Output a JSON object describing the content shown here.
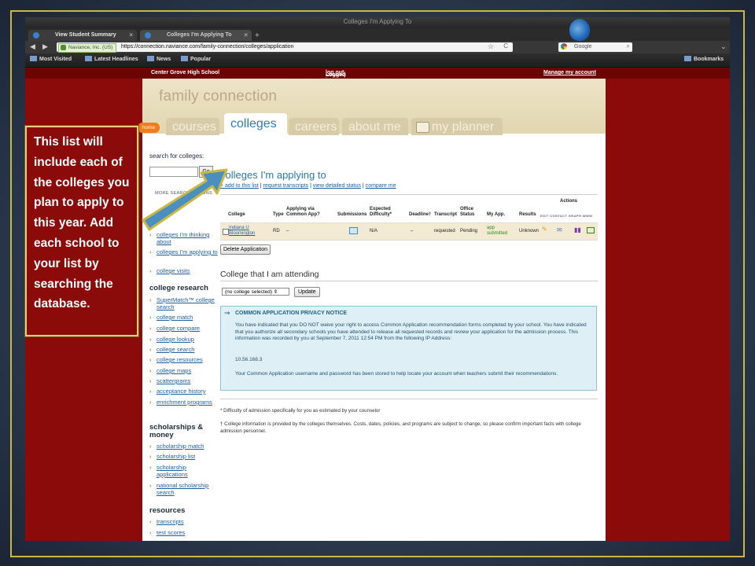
{
  "browser": {
    "window_title": "Colleges I'm Applying To",
    "tabs": [
      {
        "label": "View Student Summary"
      },
      {
        "label": "Colleges I'm Applying To"
      }
    ],
    "site_identity": "Naviance, Inc. (US)",
    "url": "https://connection.naviance.com/family-connection/colleges/application",
    "search_engine": "Google",
    "bookmarks": [
      "Most Visited",
      "Latest Headlines",
      "News",
      "Popular"
    ],
    "bookmarks_menu": "Bookmarks"
  },
  "site_bar": {
    "school": "Center Grove High School",
    "logged_in_prefix": "Logged in as: Janit P Pandya (",
    "logout": "log out",
    "logged_in_suffix": ")",
    "manage": "Manage my account"
  },
  "header": {
    "brand": "family connection",
    "home": "home",
    "tabs": [
      "courses",
      "colleges",
      "careers",
      "about me",
      "my planner"
    ]
  },
  "sidebar": {
    "search_label": "search for colleges:",
    "go": "Go",
    "more_options": "MORE SEARCH OPTIONS",
    "my_colleges_links": [
      "colleges I'm thinking about",
      "colleges I'm applying to",
      "college visits"
    ],
    "college_research_title": "college research",
    "college_research_links": [
      "SuperMatch™ college search",
      "college match",
      "college compare",
      "college lookup",
      "college search",
      "college resources",
      "college maps",
      "scattergrams",
      "acceptance history",
      "enrichment programs"
    ],
    "scholarships_title": "scholarships & money",
    "scholarship_links": [
      "scholarship match",
      "scholarship list",
      "scholarship applications",
      "national scholarship search"
    ],
    "resources_title": "resources",
    "resources_links": [
      "transcripts",
      "test scores"
    ]
  },
  "main": {
    "title": "colleges I'm applying to",
    "links": [
      "+ add to this list",
      "request transcripts",
      "view detailed status",
      "compare me"
    ],
    "table": {
      "actions_label": "Actions",
      "action_headers": "EDIT CONTACT GRAPH WWW",
      "headers": [
        "College",
        "Type",
        "Applying via Common App?",
        "Submissions",
        "Expected Difficulty*",
        "Deadline†",
        "Transcript",
        "Office Status",
        "My App.",
        "Results"
      ],
      "row": {
        "college": "Indiana U Bloomington",
        "type": "RD",
        "common_app": "–",
        "difficulty": "N/A",
        "deadline": "–",
        "transcript": "requested",
        "office_status": "Pending",
        "my_app": "app submitted",
        "results": "Unknown"
      }
    },
    "delete_button": "Delete Application",
    "attending_title": "College that I am attending",
    "attending_select": "(no college selected)",
    "update_button": "Update",
    "notice": {
      "title": "COMMON APPLICATION PRIVACY NOTICE",
      "p1": "You have indicated that you DO NOT waive your right to access Common Application recommendation forms completed by your school. You have indicated that you authorize all secondary schools you have attended to release all requested records and review your application for the admission process. This information was recorded by you at September 7, 2011 12:54 PM from the following IP Address:",
      "ip": "10.56.168.3",
      "p2": "Your Common Application username and password has been stored to help locate your account when teachers submit their recommendations."
    },
    "footnote1": "* Difficulty of admission specifically for you as estimated by your counselor",
    "footnote2": "† College information is provided by the colleges themselves. Costs, dates, policies, and programs are subject to change, so please confirm important facts with college admission personnel."
  },
  "callout": {
    "text": "This list will include each of the colleges you plan to apply to this year.  Add each school to your list by searching the database."
  },
  "colors": {
    "accent_blue": "#2b7aaa",
    "maroon": "#8b0a0a",
    "gold_border": "#e8d07a",
    "arrow_fill": "#4a8fc0"
  }
}
